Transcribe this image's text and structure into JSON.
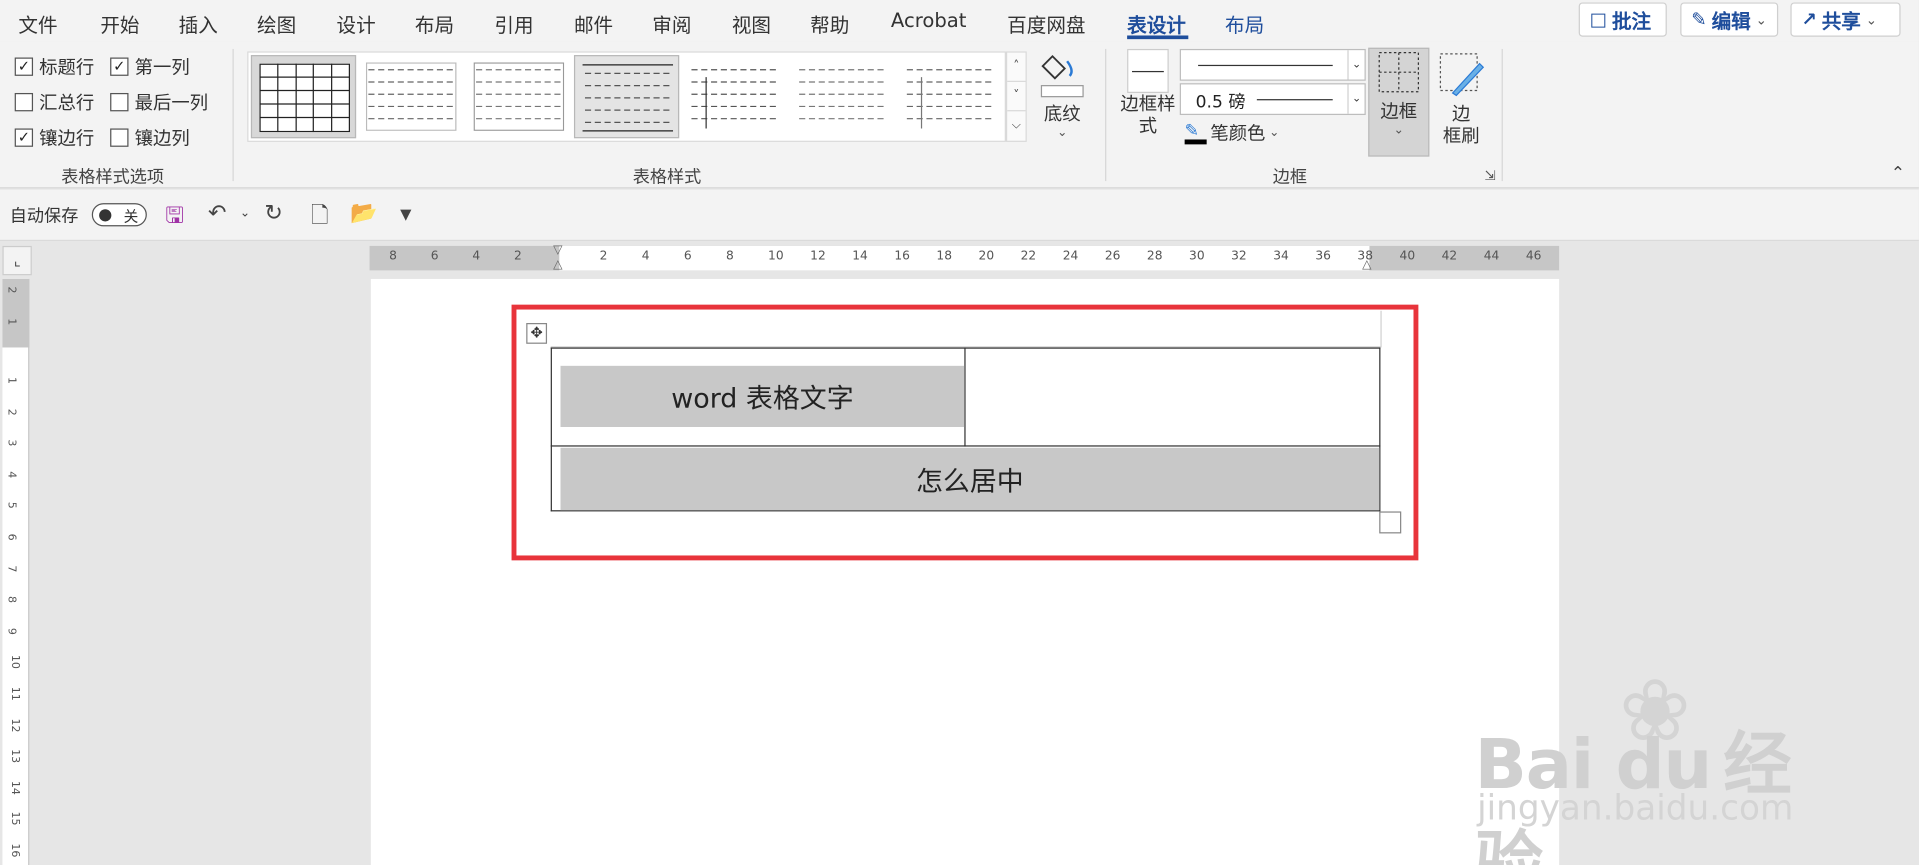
{
  "tabs": [
    "文件",
    "开始",
    "插入",
    "绘图",
    "设计",
    "布局",
    "引用",
    "邮件",
    "审阅",
    "视图",
    "帮助",
    "Acrobat",
    "百度网盘",
    "表设计",
    "布局"
  ],
  "active_tab": "表设计",
  "top_buttons": {
    "comment": "批注",
    "edit": "编辑",
    "share": "共享"
  },
  "style_options": {
    "header_row": "标题行",
    "first_column": "第一列",
    "total_row": "汇总行",
    "last_column": "最后一列",
    "banded_rows": "镶边行",
    "banded_columns": "镶边列",
    "group_label": "表格样式选项"
  },
  "table_styles": {
    "group_label": "表格样式"
  },
  "shading": {
    "label": "底纹"
  },
  "borders": {
    "border_styles": "边框样\n式",
    "weight": "0.5 磅",
    "pen_color": "笔颜色",
    "borders_btn": "边框",
    "border_painter": "边\n框刷",
    "group_label": "边框"
  },
  "qat": {
    "autosave": "自动保存",
    "toggle_state": "关"
  },
  "ruler_numbers": [
    "8",
    "6",
    "4",
    "2",
    "2",
    "4",
    "6",
    "8",
    "10",
    "12",
    "14",
    "16",
    "18",
    "20",
    "22",
    "24",
    "26",
    "28",
    "30",
    "32",
    "34",
    "36",
    "38",
    "40",
    "42",
    "44",
    "46"
  ],
  "vruler_numbers": [
    "2",
    "1",
    "1",
    "2",
    "3",
    "4",
    "5",
    "6",
    "7",
    "8",
    "9",
    "10",
    "11",
    "12",
    "13",
    "14",
    "15",
    "16"
  ],
  "document": {
    "cell1": "word 表格文字",
    "cell3": "怎么居中"
  },
  "watermark": {
    "brand": "Bai  du",
    "brand2": "经验",
    "url": "jingyan.baidu.com"
  }
}
